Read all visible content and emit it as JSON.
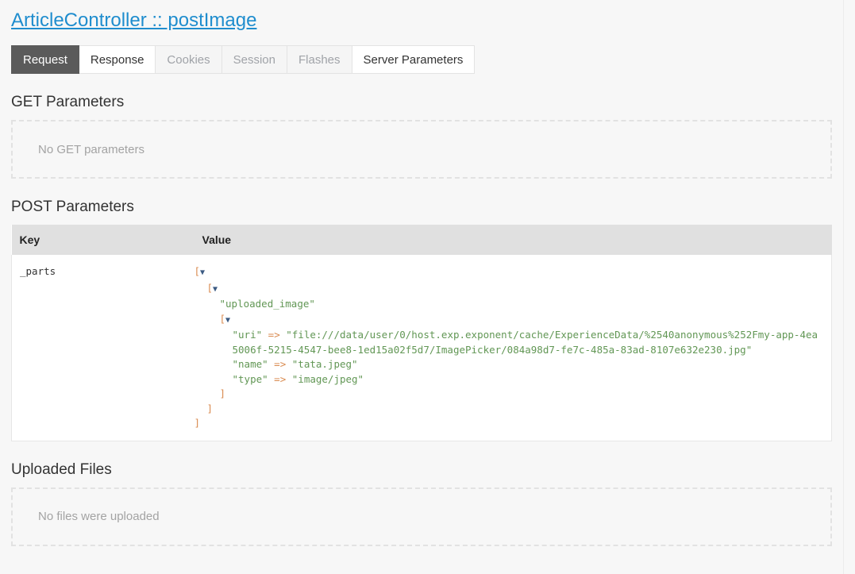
{
  "header": {
    "title": "ArticleController :: postImage"
  },
  "tabs": [
    {
      "label": "Request",
      "state": "active"
    },
    {
      "label": "Response",
      "state": "enabled"
    },
    {
      "label": "Cookies",
      "state": "disabled"
    },
    {
      "label": "Session",
      "state": "disabled"
    },
    {
      "label": "Flashes",
      "state": "disabled"
    },
    {
      "label": "Server Parameters",
      "state": "enabled"
    }
  ],
  "sections": {
    "get": {
      "heading": "GET Parameters",
      "empty_text": "No GET parameters"
    },
    "post": {
      "heading": "POST Parameters",
      "columns": {
        "key": "Key",
        "value": "Value"
      },
      "rows": [
        {
          "key": "_parts",
          "value_lines": [
            {
              "indent": 0,
              "parts": [
                {
                  "t": "[",
                  "c": "punct"
                },
                {
                  "t": "▼",
                  "c": "toggle"
                }
              ]
            },
            {
              "indent": 1,
              "parts": [
                {
                  "t": "[",
                  "c": "punct"
                },
                {
                  "t": "▼",
                  "c": "toggle"
                }
              ]
            },
            {
              "indent": 2,
              "parts": [
                {
                  "t": "\"uploaded_image\"",
                  "c": "str"
                }
              ]
            },
            {
              "indent": 2,
              "parts": [
                {
                  "t": "[",
                  "c": "punct"
                },
                {
                  "t": "▼",
                  "c": "toggle"
                }
              ]
            },
            {
              "indent": 3,
              "parts": [
                {
                  "t": "\"uri\"",
                  "c": "str"
                },
                {
                  "t": " => ",
                  "c": "arrow"
                },
                {
                  "t": "\"file:///data/user/0/host.exp.exponent/cache/ExperienceData/%2540anonymous%252Fmy-app-4ea5006f-5215-4547-bee8-1ed15a02f5d7/ImagePicker/084a98d7-fe7c-485a-83ad-8107e632e230.jpg\"",
                  "c": "str"
                }
              ]
            },
            {
              "indent": 3,
              "parts": [
                {
                  "t": "\"name\"",
                  "c": "str"
                },
                {
                  "t": " => ",
                  "c": "arrow"
                },
                {
                  "t": "\"tata.jpeg\"",
                  "c": "str"
                }
              ]
            },
            {
              "indent": 3,
              "parts": [
                {
                  "t": "\"type\"",
                  "c": "str"
                },
                {
                  "t": " => ",
                  "c": "arrow"
                },
                {
                  "t": "\"image/jpeg\"",
                  "c": "str"
                }
              ]
            },
            {
              "indent": 2,
              "parts": [
                {
                  "t": "]",
                  "c": "punct"
                }
              ]
            },
            {
              "indent": 1,
              "parts": [
                {
                  "t": "]",
                  "c": "punct"
                }
              ]
            },
            {
              "indent": 0,
              "parts": [
                {
                  "t": "]",
                  "c": "punct"
                }
              ]
            }
          ]
        }
      ]
    },
    "files": {
      "heading": "Uploaded Files",
      "empty_text": "No files were uploaded"
    }
  },
  "colors": {
    "link": "#1f8dce",
    "active_tab_bg": "#5b5b5b",
    "table_header_bg": "#e0e0e0",
    "string": "#629755",
    "punctuation": "#d98a4f",
    "toggle": "#3b5a82",
    "muted_text": "#a3a3a3"
  }
}
